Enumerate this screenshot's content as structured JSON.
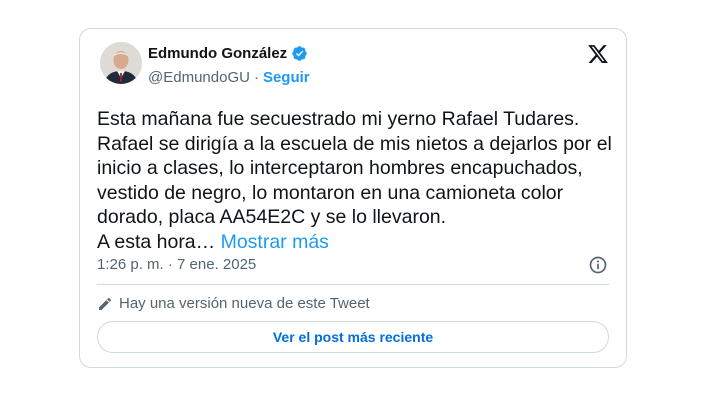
{
  "author": {
    "name": "Edmundo González",
    "handle": "@EdmundoGU",
    "separator": "·",
    "follow_label": "Seguir"
  },
  "icons": {
    "verified": "verified-badge-icon",
    "logo": "x-logo-icon",
    "info": "info-icon",
    "edit": "pencil-icon"
  },
  "tweet": {
    "text": "Esta mañana fue secuestrado mi yerno Rafael Tudares.\nRafael se dirigía a la escuela de mis nietos a dejarlos por el inicio a clases, lo interceptaron hombres encapuchados, vestido de negro, lo montaron en una camioneta color dorado, placa AA54E2C y se lo llevaron.\nA esta hora… ",
    "more_label": "Mostrar más",
    "timestamp": "1:26 p. m. · 7 ene. 2025"
  },
  "notice": {
    "text": "Hay una versión nueva de este Tweet",
    "button_label": "Ver el post más reciente"
  },
  "colors": {
    "accent": "#1d9bf0",
    "button_text": "#006fd6",
    "secondary_text": "#536471",
    "border": "#cfd9de"
  }
}
